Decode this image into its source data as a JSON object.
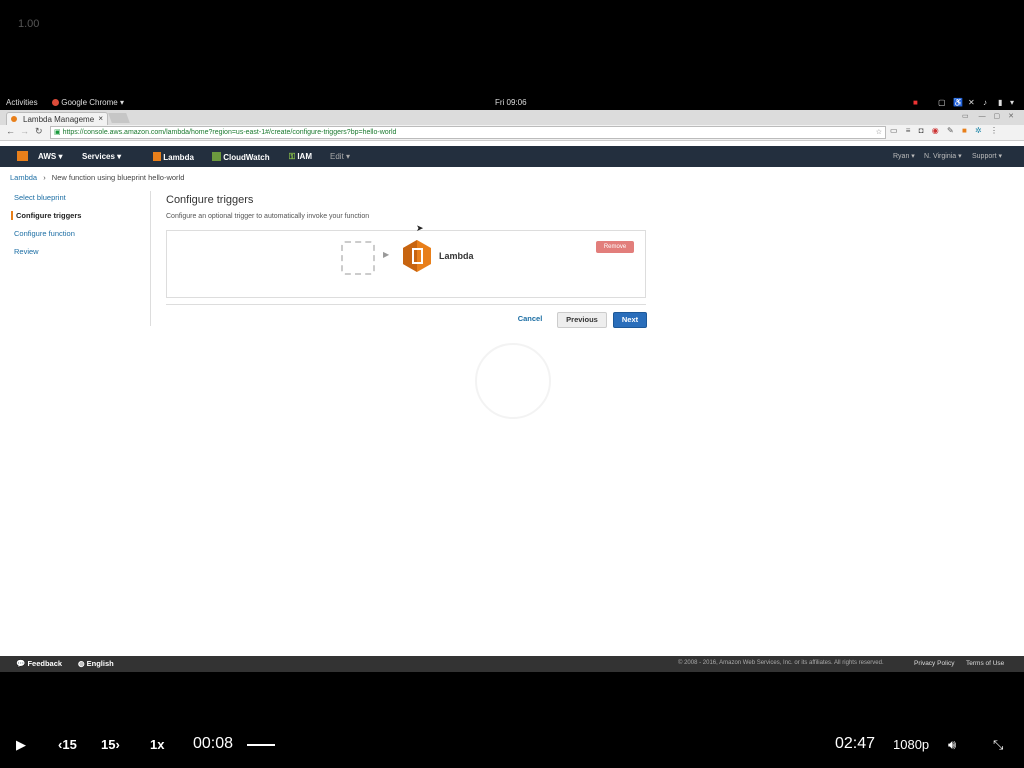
{
  "video_overlay": {
    "speed_readout": "1.00"
  },
  "gnome_bar": {
    "activities": "Activities",
    "app_menu": "Google Chrome",
    "clock": "Fri 09:06"
  },
  "browser": {
    "tab_title": "Lambda Manageme",
    "url": "https://console.aws.amazon.com/lambda/home?region=us-east-1#/create/configure-triggers?bp=hello-world"
  },
  "aws_nav": {
    "aws": "AWS",
    "services": "Services",
    "lambda": "Lambda",
    "cloudwatch": "CloudWatch",
    "iam": "IAM",
    "edit": "Edit",
    "account": "Ryan",
    "region": "N. Virginia",
    "support": "Support"
  },
  "breadcrumb": {
    "root": "Lambda",
    "current": "New function using blueprint hello-world"
  },
  "steps": [
    "Select blueprint",
    "Configure triggers",
    "Configure function",
    "Review"
  ],
  "main": {
    "heading": "Configure triggers",
    "subheading": "Configure an optional trigger to automatically invoke your function",
    "function_label": "Lambda",
    "remove_label": "Remove",
    "cancel_label": "Cancel",
    "previous_label": "Previous",
    "next_label": "Next"
  },
  "footer": {
    "feedback": "Feedback",
    "language": "English",
    "copyright": "© 2008 - 2016, Amazon Web Services, Inc. or its affiliates. All rights reserved.",
    "privacy": "Privacy Policy",
    "terms": "Terms of Use"
  },
  "player": {
    "rewind_label": "15",
    "forward_label": "15",
    "playback_rate": "1x",
    "current_time": "00:08",
    "duration": "02:47",
    "quality": "1080p"
  },
  "colors": {
    "aws_nav_bg": "#232f3e",
    "lambda_orange": "#e87f1a",
    "next_blue": "#2a6ebb",
    "remove_red": "#d9534f"
  }
}
